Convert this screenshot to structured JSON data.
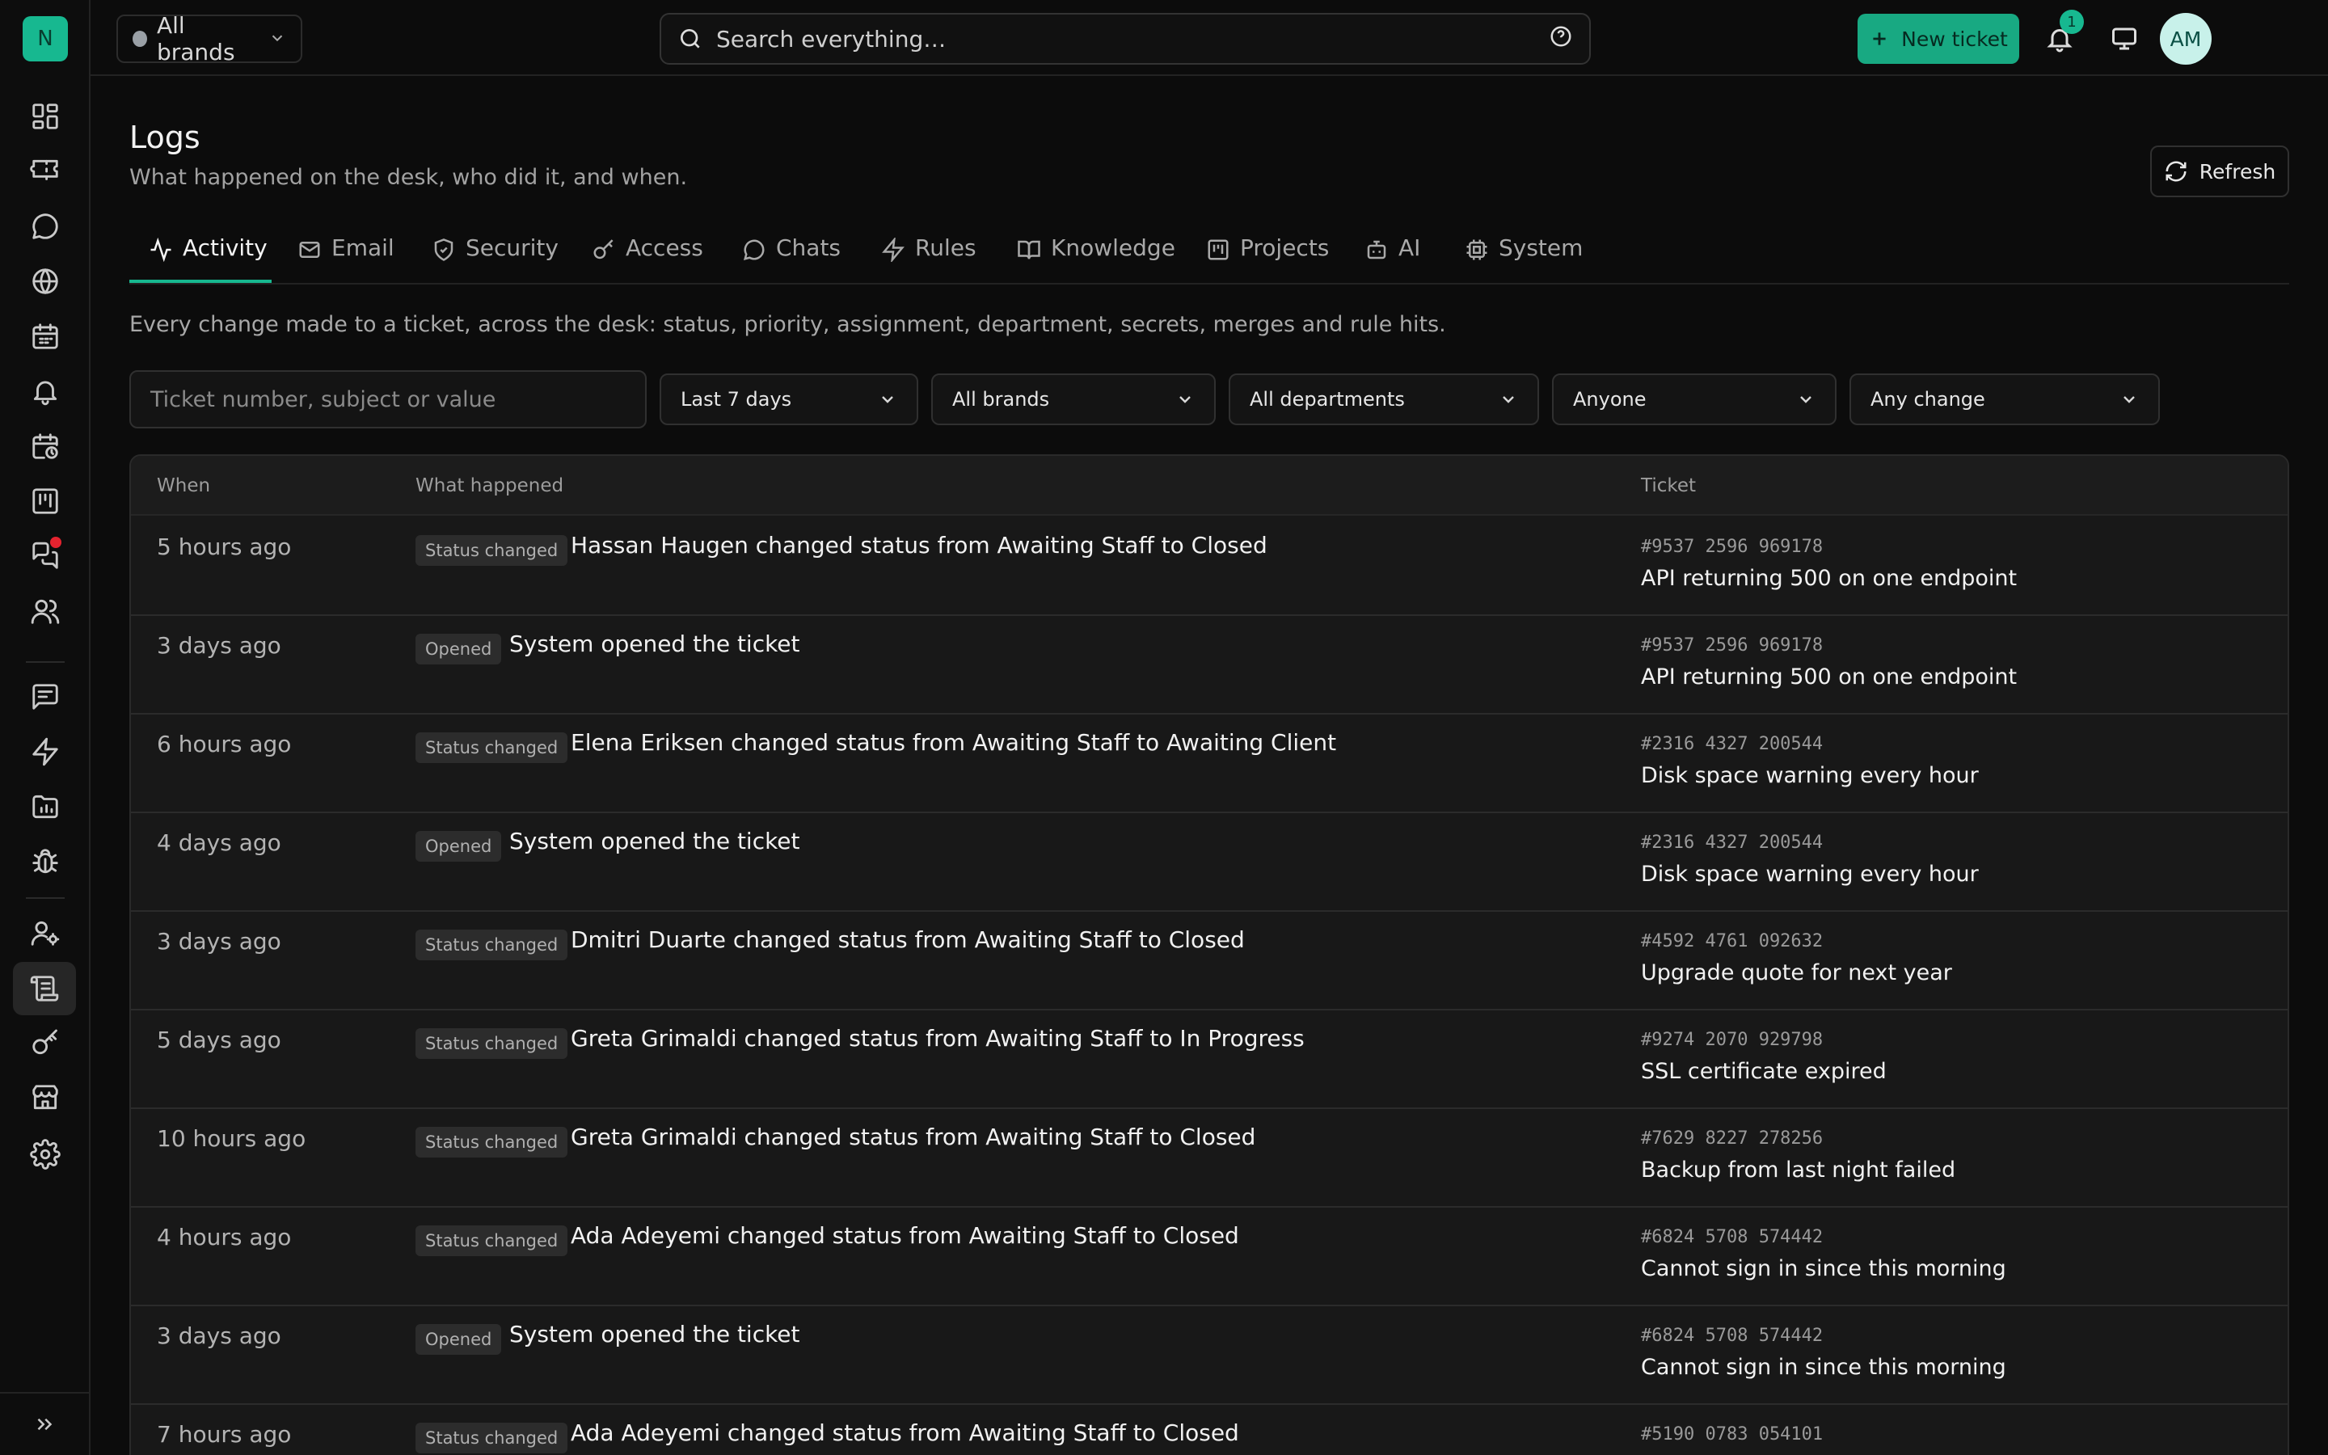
{
  "sidebar": {
    "logo": "N"
  },
  "topbar": {
    "brand_select": "All brands",
    "search_placeholder": "Search everything…",
    "new_ticket": "New ticket",
    "notifications_count": "1",
    "avatar_initials": "AM"
  },
  "page": {
    "title": "Logs",
    "subtitle": "What happened on the desk, who did it, and when.",
    "refresh": "Refresh",
    "tabs": [
      {
        "label": "Activity"
      },
      {
        "label": "Email"
      },
      {
        "label": "Security"
      },
      {
        "label": "Access"
      },
      {
        "label": "Chats"
      },
      {
        "label": "Rules"
      },
      {
        "label": "Knowledge"
      },
      {
        "label": "Projects"
      },
      {
        "label": "AI"
      },
      {
        "label": "System"
      }
    ],
    "description": "Every change made to a ticket, across the desk: status, priority, assignment, department, secrets, merges and rule hits."
  },
  "filters": {
    "search_placeholder": "Ticket number, subject or value",
    "range": "Last 7 days",
    "brand": "All brands",
    "department": "All departments",
    "actor": "Anyone",
    "change": "Any change"
  },
  "table": {
    "headers": {
      "when": "When",
      "what": "What happened",
      "ticket": "Ticket"
    },
    "rows": [
      {
        "when": "5 hours ago",
        "type": "Status changed",
        "text": "Hassan Haugen changed status from Awaiting Staff to Closed",
        "ticket": "#9537 2596 969178",
        "subject": "API returning 500 on one endpoint"
      },
      {
        "when": "3 days ago",
        "type": "Opened",
        "text": "System opened the ticket",
        "ticket": "#9537 2596 969178",
        "subject": "API returning 500 on one endpoint"
      },
      {
        "when": "6 hours ago",
        "type": "Status changed",
        "text": "Elena Eriksen changed status from Awaiting Staff to Awaiting Client",
        "ticket": "#2316 4327 200544",
        "subject": "Disk space warning every hour"
      },
      {
        "when": "4 days ago",
        "type": "Opened",
        "text": "System opened the ticket",
        "ticket": "#2316 4327 200544",
        "subject": "Disk space warning every hour"
      },
      {
        "when": "3 days ago",
        "type": "Status changed",
        "text": "Dmitri Duarte changed status from Awaiting Staff to Closed",
        "ticket": "#4592 4761 092632",
        "subject": "Upgrade quote for next year"
      },
      {
        "when": "5 days ago",
        "type": "Status changed",
        "text": "Greta Grimaldi changed status from Awaiting Staff to In Progress",
        "ticket": "#9274 2070 929798",
        "subject": "SSL certificate expired"
      },
      {
        "when": "10 hours ago",
        "type": "Status changed",
        "text": "Greta Grimaldi changed status from Awaiting Staff to Closed",
        "ticket": "#7629 8227 278256",
        "subject": "Backup from last night failed"
      },
      {
        "when": "4 hours ago",
        "type": "Status changed",
        "text": "Ada Adeyemi changed status from Awaiting Staff to Closed",
        "ticket": "#6824 5708 574442",
        "subject": "Cannot sign in since this morning"
      },
      {
        "when": "3 days ago",
        "type": "Opened",
        "text": "System opened the ticket",
        "ticket": "#6824 5708 574442",
        "subject": "Cannot sign in since this morning"
      },
      {
        "when": "7 hours ago",
        "type": "Status changed",
        "text": "Ada Adeyemi changed status from Awaiting Staff to Closed",
        "ticket": "#5190 0783 054101",
        "subject": ""
      }
    ]
  },
  "colors": {
    "accent": "#17b890",
    "background": "#0c0c0c",
    "notification_dot": "#e5232f"
  }
}
